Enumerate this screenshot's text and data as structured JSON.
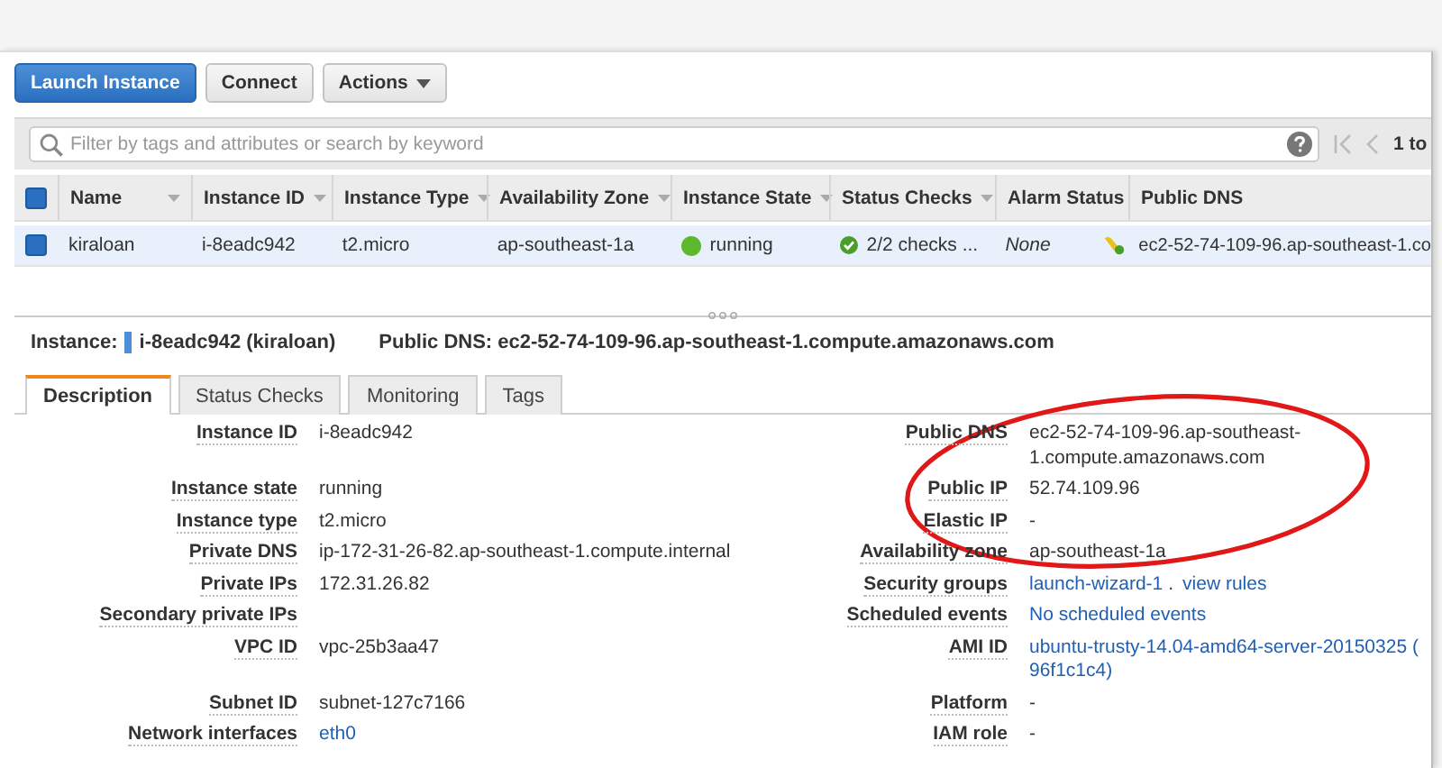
{
  "toolbar": {
    "buttons": [
      {
        "label": "Launch Instance",
        "kind": "primary",
        "dropdown": false
      },
      {
        "label": "Connect",
        "kind": "default",
        "dropdown": false
      },
      {
        "label": "Actions",
        "kind": "default",
        "dropdown": true
      }
    ]
  },
  "filter": {
    "placeholder": "Filter by tags and attributes or search by keyword",
    "pagination": "1 to"
  },
  "table": {
    "all_checked": true,
    "columns": [
      {
        "label": "Name",
        "sort_caret": true
      },
      {
        "label": "Instance ID",
        "sort_caret": true
      },
      {
        "label": "Instance Type",
        "sort_caret": true
      },
      {
        "label": "Availability Zone",
        "sort_caret": true
      },
      {
        "label": "Instance State",
        "sort_caret": true
      },
      {
        "label": "Status Checks",
        "sort_caret": true
      },
      {
        "label": "Alarm Status",
        "sort_caret": false
      },
      {
        "label": "Public DNS",
        "sort_caret": false
      }
    ],
    "rows": [
      {
        "selected": true,
        "checked": true,
        "name": "kiraloan",
        "instance_id": "i-8eadc942",
        "instance_type": "t2.micro",
        "availability_zone": "ap-southeast-1a",
        "state": "running",
        "color": "#5cb82e",
        "status_checks": "2/2 checks ...",
        "alarm_status": "None",
        "public_dns": "ec2-52-74-109-96.ap-southeast-1.co"
      }
    ]
  },
  "instance_bar": {
    "label": "Instance:",
    "instance": "i-8eadc942 (kiraloan)",
    "public_dns": "Public DNS: ec2-52-74-109-96.ap-southeast-1.compute.amazonaws.com"
  },
  "tabs": [
    {
      "label": "Description",
      "selected": true
    },
    {
      "label": "Status Checks",
      "selected": false
    },
    {
      "label": "Monitoring",
      "selected": false
    },
    {
      "label": "Tags",
      "selected": false
    }
  ],
  "details": [
    {
      "left": {
        "label": "Instance ID",
        "parts": [
          {
            "kind": "text",
            "text": "i-8eadc942"
          }
        ]
      },
      "right": {
        "label": "Public DNS",
        "parts": [
          {
            "kind": "text",
            "text": "ec2-52-74-109-96.ap-southeast-"
          },
          {
            "kind": "break"
          },
          {
            "kind": "text",
            "text": "1.compute.amazonaws.com"
          }
        ]
      }
    },
    {
      "left": {
        "label": "Instance state",
        "parts": [
          {
            "kind": "text",
            "text": "running"
          }
        ]
      },
      "right": {
        "label": "Public IP",
        "parts": [
          {
            "kind": "text",
            "text": "52.74.109.96"
          }
        ]
      }
    },
    {
      "left": {
        "label": "Instance type",
        "parts": [
          {
            "kind": "text",
            "text": "t2.micro"
          }
        ]
      },
      "right": {
        "label": "Elastic IP",
        "parts": [
          {
            "kind": "text",
            "text": "-"
          }
        ]
      }
    },
    {
      "left": {
        "label": "Private DNS",
        "parts": [
          {
            "kind": "text",
            "text": "ip-172-31-26-82.ap-southeast-1.compute.internal"
          }
        ]
      },
      "right": {
        "label": "Availability zone",
        "parts": [
          {
            "kind": "text",
            "text": "ap-southeast-1a"
          }
        ]
      }
    },
    {
      "left": {
        "label": "Private IPs",
        "parts": [
          {
            "kind": "text",
            "text": "172.31.26.82"
          }
        ]
      },
      "right": {
        "label": "Security groups",
        "parts": [
          {
            "kind": "link",
            "text": "launch-wizard-1"
          },
          {
            "kind": "text",
            "text": "."
          },
          {
            "kind": "link",
            "text": "view rules"
          }
        ]
      }
    },
    {
      "left": {
        "label": "Secondary private IPs"
      },
      "right": {
        "label": "Scheduled events",
        "parts": [
          {
            "kind": "link",
            "text": "No scheduled events"
          }
        ]
      }
    },
    {
      "left": {
        "label": "VPC ID",
        "parts": [
          {
            "kind": "text",
            "text": "vpc-25b3aa47"
          }
        ]
      },
      "right": {
        "label": "AMI ID",
        "parts": [
          {
            "kind": "link",
            "text": "ubuntu-trusty-14.04-amd64-server-20150325 ("
          },
          {
            "kind": "break"
          },
          {
            "kind": "link",
            "text": "96f1c1c4)"
          }
        ]
      }
    },
    {
      "left": {
        "label": "Subnet ID",
        "parts": [
          {
            "kind": "text",
            "text": "subnet-127c7166"
          }
        ]
      },
      "right": {
        "label": "Platform",
        "parts": [
          {
            "kind": "text",
            "text": "-"
          }
        ]
      }
    },
    {
      "left": {
        "label": "Network interfaces",
        "parts": [
          {
            "kind": "link",
            "text": "eth0"
          }
        ]
      },
      "right": {
        "label": "IAM role",
        "parts": [
          {
            "kind": "text",
            "text": "-"
          }
        ]
      }
    }
  ],
  "annotation": {
    "kind": "ellipse",
    "color": "#e01818"
  }
}
